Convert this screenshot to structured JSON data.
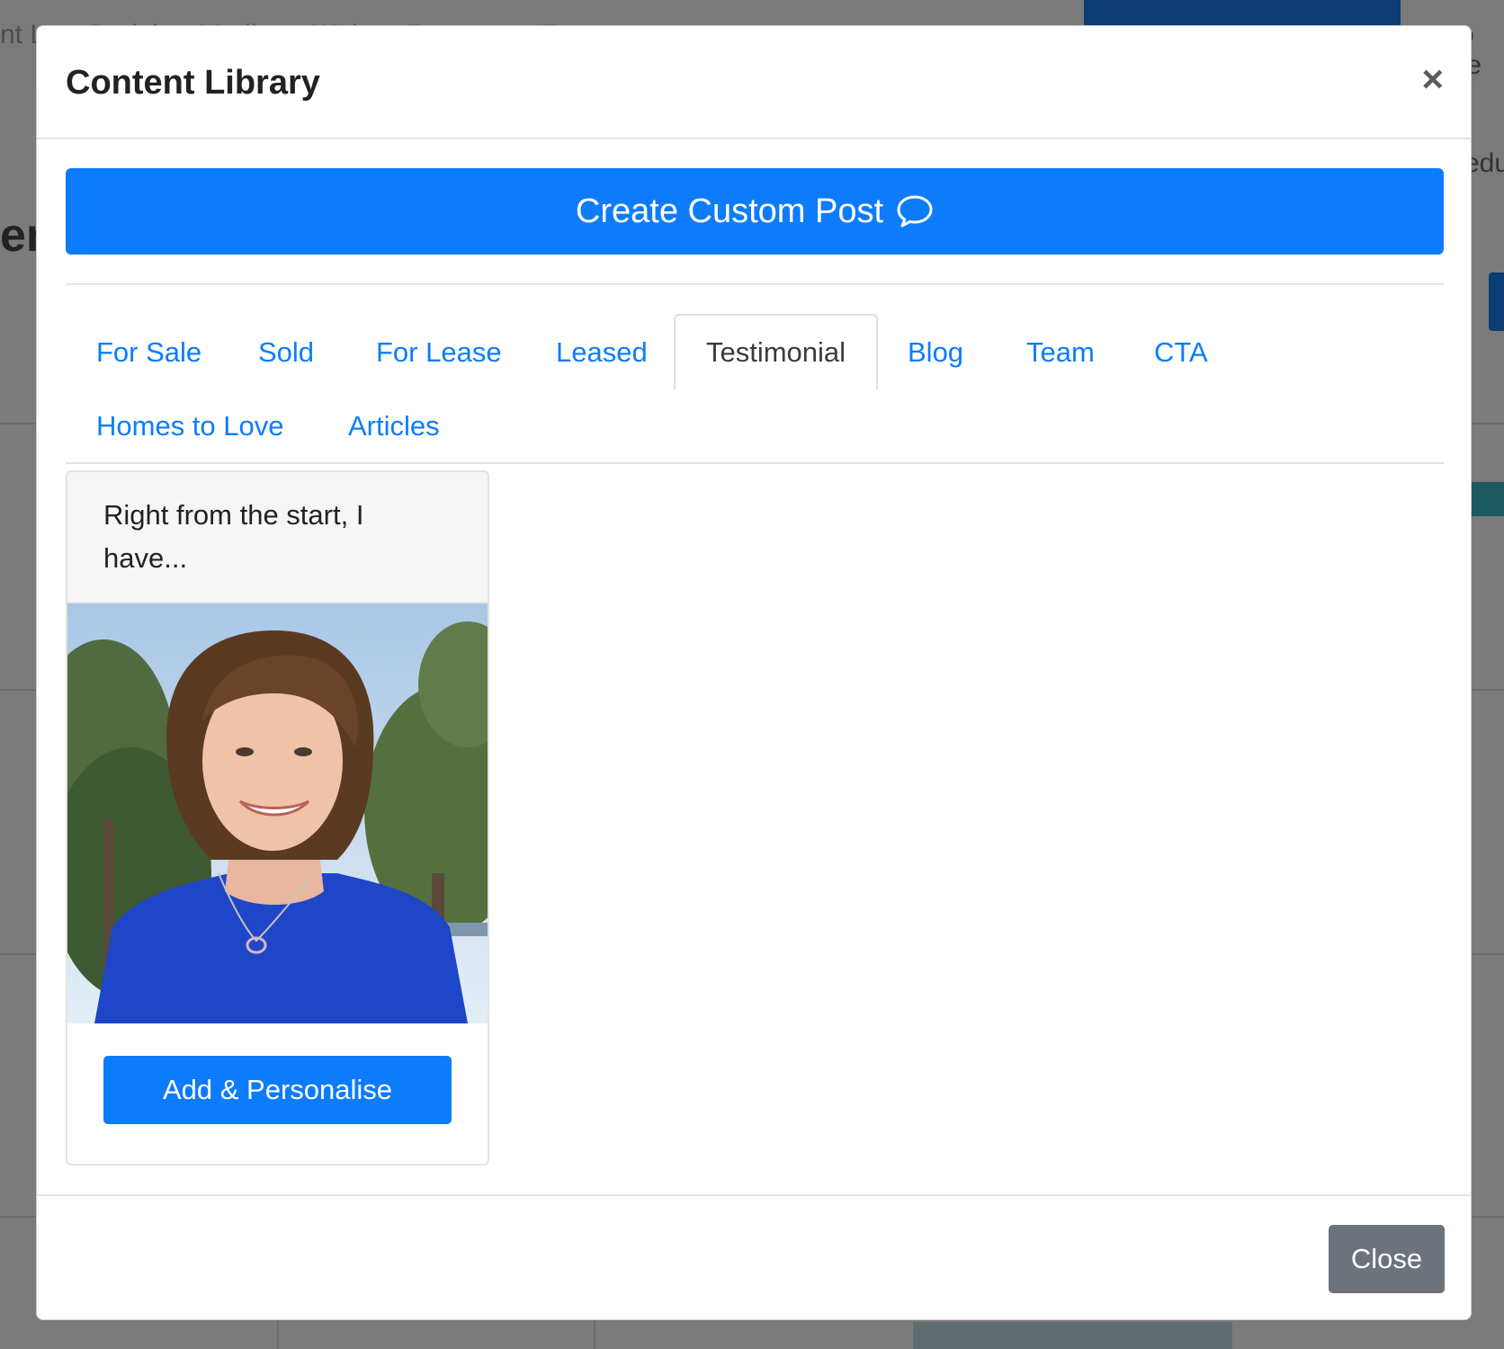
{
  "background": {
    "nav_items": [
      "nt L",
      "Social",
      "Media",
      "Web",
      "Reports",
      "Re"
    ],
    "right_partial_top": "o te",
    "right_partial_mid": "edu",
    "left_big": "en"
  },
  "modal": {
    "title": "Content Library",
    "close_icon": "×",
    "create_button_label": "Create Custom Post",
    "create_button_icon": "speech-bubble-icon",
    "tabs": [
      {
        "label": "For Sale"
      },
      {
        "label": "Sold"
      },
      {
        "label": "For Lease"
      },
      {
        "label": "Leased"
      },
      {
        "label": "Testimonial",
        "active": true
      },
      {
        "label": "Blog"
      },
      {
        "label": "Team"
      },
      {
        "label": "CTA"
      },
      {
        "label": "Homes to Love"
      },
      {
        "label": "Articles"
      }
    ],
    "card": {
      "text": "Right from the start, I have...",
      "button_label": "Add & Personalise"
    },
    "footer_close_label": "Close"
  },
  "colors": {
    "primary": "#0d7cfc",
    "secondary": "#6c737b",
    "overlay": "#7b7b7b"
  }
}
